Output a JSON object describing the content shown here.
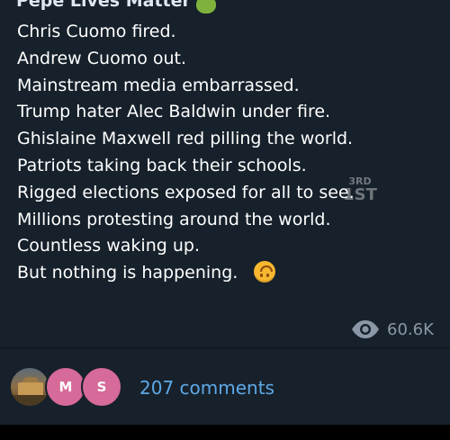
{
  "post": {
    "channel_name": "Pepe Lives Matter",
    "channel_emoji": "frog-emoji",
    "lines": [
      "Chris Cuomo fired.",
      "Andrew Cuomo out.",
      "Mainstream media embarrassed.",
      "Trump hater Alec Baldwin under fire.",
      "Ghislaine Maxwell red pilling the world.",
      "Patriots taking back their schools.",
      "Rigged elections exposed for all to see.",
      "Millions protesting around the world.",
      "Countless waking up.",
      "But nothing is happening."
    ],
    "last_line_emoji": "upside-down-face-emoji",
    "views": "60.6K",
    "view_icon": "eye-icon"
  },
  "watermark": {
    "top": "3RD",
    "bottom": "1ST"
  },
  "comments": {
    "avatar_letters": [
      "M",
      "S"
    ],
    "link_text": "207 comments"
  },
  "colors": {
    "message_background": "#17212b",
    "message_text": "#ffffff",
    "views_text": "#8b97a6",
    "link": "#5ea9e6",
    "avatar_pink": "#d66a98"
  }
}
